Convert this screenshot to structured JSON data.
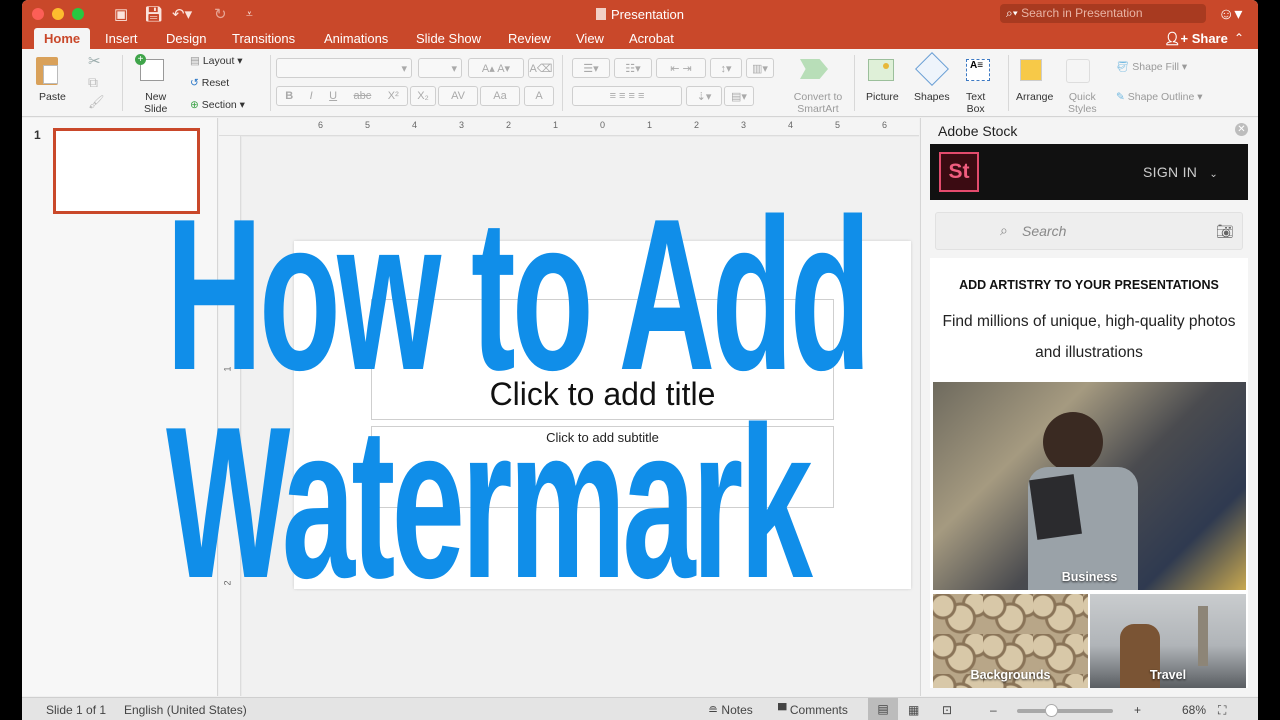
{
  "window": {
    "title": "Presentation",
    "search_placeholder": "Search in Presentation",
    "quick_access": [
      "sidebar-toggle",
      "save",
      "undo",
      "redo",
      "customize"
    ]
  },
  "tabs": [
    {
      "label": "Home",
      "active": true
    },
    {
      "label": "Insert"
    },
    {
      "label": "Design"
    },
    {
      "label": "Transitions"
    },
    {
      "label": "Animations"
    },
    {
      "label": "Slide Show"
    },
    {
      "label": "Review"
    },
    {
      "label": "View"
    },
    {
      "label": "Acrobat"
    }
  ],
  "share_label": "Share",
  "ribbon": {
    "paste": "Paste",
    "new_slide_1": "New",
    "new_slide_2": "Slide",
    "layout": "Layout",
    "reset": "Reset",
    "section": "Section",
    "format": [
      "B",
      "I",
      "U",
      "abc",
      "X²",
      "X₂",
      "AV",
      "Aa",
      "A"
    ],
    "convert_1": "Convert to",
    "convert_2": "SmartArt",
    "picture": "Picture",
    "shapes": "Shapes",
    "textbox_1": "Text",
    "textbox_2": "Box",
    "arrange": "Arrange",
    "quick_styles_1": "Quick",
    "quick_styles_2": "Styles",
    "shape_fill": "Shape Fill",
    "shape_outline": "Shape Outline"
  },
  "thumbnails": [
    {
      "number": "1"
    }
  ],
  "ruler": {
    "horizontal": [
      "6",
      "5",
      "4",
      "3",
      "2",
      "1",
      "0",
      "1",
      "2",
      "3",
      "4",
      "5",
      "6"
    ],
    "vertical": [
      "1",
      "2"
    ]
  },
  "slide": {
    "title_placeholder": "Click to add title",
    "subtitle_placeholder": "Click to add subtitle"
  },
  "adobe_stock": {
    "panel_title": "Adobe Stock",
    "logo": "St",
    "sign_in": "SIGN IN",
    "search_placeholder": "Search",
    "tagline": "ADD ARTISTRY TO YOUR PRESENTATIONS",
    "description": "Find millions of unique, high-quality photos and illustrations",
    "categories": [
      {
        "label": "Business"
      },
      {
        "label": "Backgrounds"
      },
      {
        "label": "Travel"
      }
    ]
  },
  "statusbar": {
    "slide_info": "Slide 1 of 1",
    "language": "English (United States)",
    "notes": "Notes",
    "comments": "Comments",
    "zoom_percent": "68%",
    "zoom_fraction": 0.35
  },
  "watermark": {
    "line1": "How to Add",
    "line2": "Watermark",
    "color": "#108ee9"
  },
  "colors": {
    "accent": "#c9482a",
    "stock_logo": "#e34b6d"
  }
}
